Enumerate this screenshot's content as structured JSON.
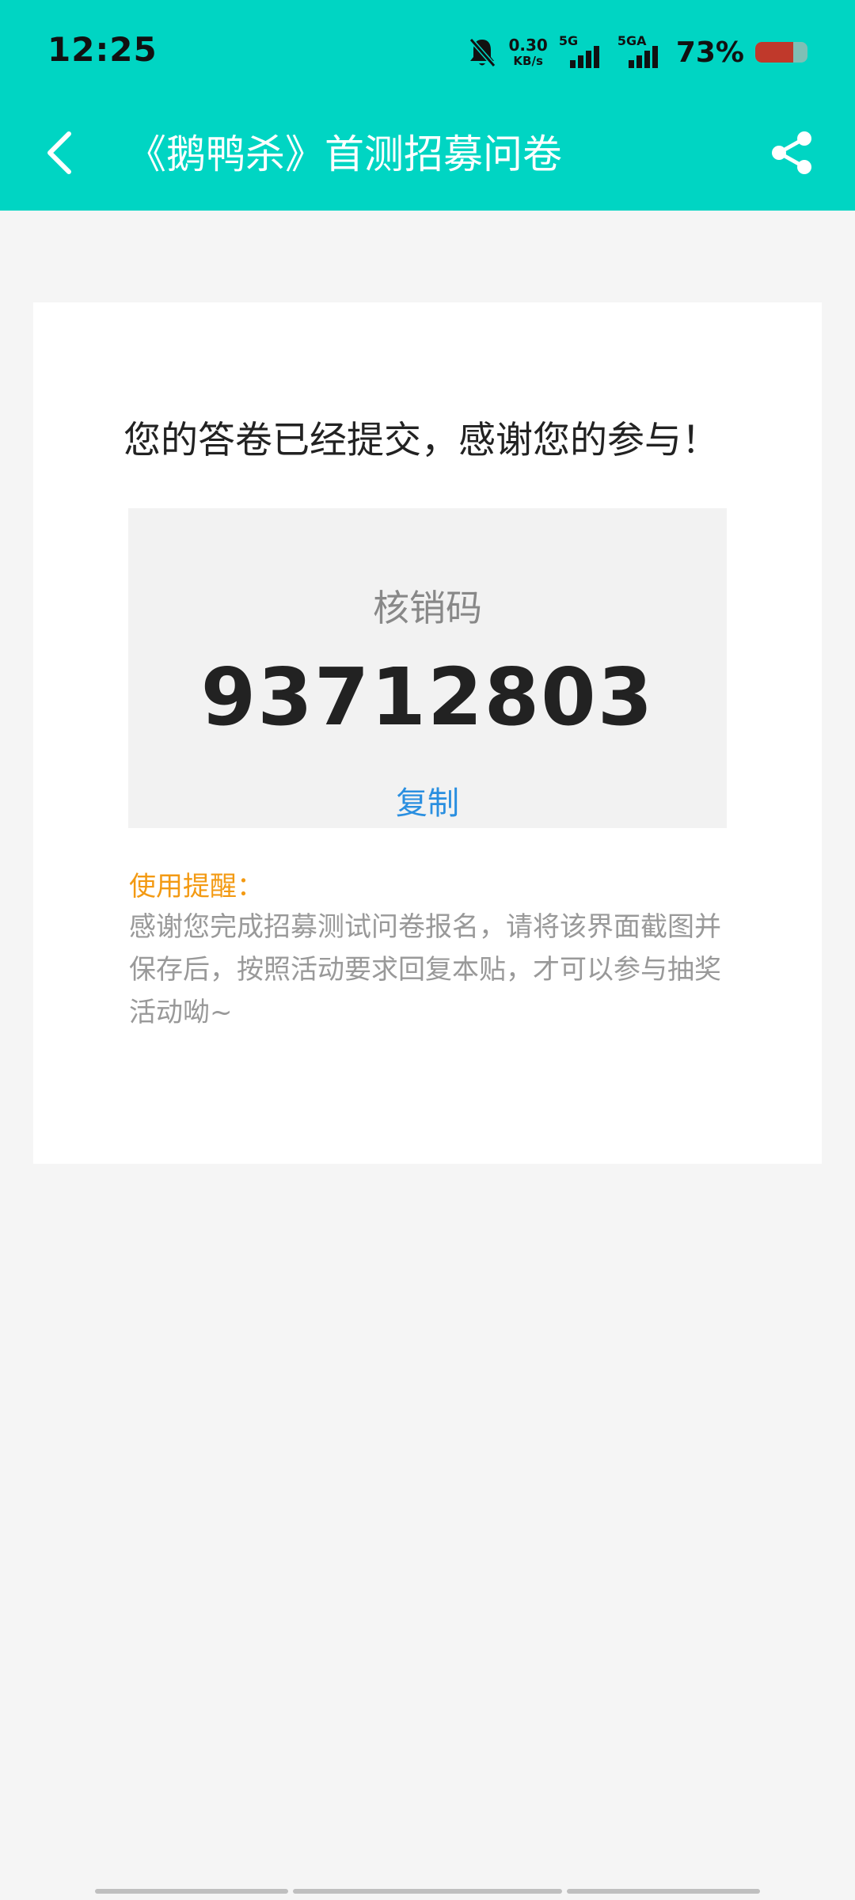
{
  "status_bar": {
    "time": "12:25",
    "net_speed_value": "0.30",
    "net_speed_unit": "KB/s",
    "sim1_label": "5G",
    "sim2_label": "5GA",
    "battery_percent": "73%",
    "battery_level": 0.73,
    "icons": [
      "bell-muted-icon",
      "signal-icon",
      "battery-icon"
    ]
  },
  "header": {
    "title": "《鹅鸭杀》首测招募问卷",
    "background_color": "#00d5c3",
    "back_icon": "chevron-left-icon",
    "share_icon": "share-icon"
  },
  "result": {
    "message": "您的答卷已经提交，感谢您的参与！",
    "code_label": "核销码",
    "code_value": "93712803",
    "copy_label": "复制"
  },
  "reminder": {
    "title": "使用提醒：",
    "text": "感谢您完成招募测试问卷报名，请将该界面截图并保存后，按照活动要求回复本贴，才可以参与抽奖活动呦~"
  },
  "colors": {
    "accent": "#00d5c3",
    "link": "#2a8fe0",
    "reminder": "#f39a13"
  }
}
